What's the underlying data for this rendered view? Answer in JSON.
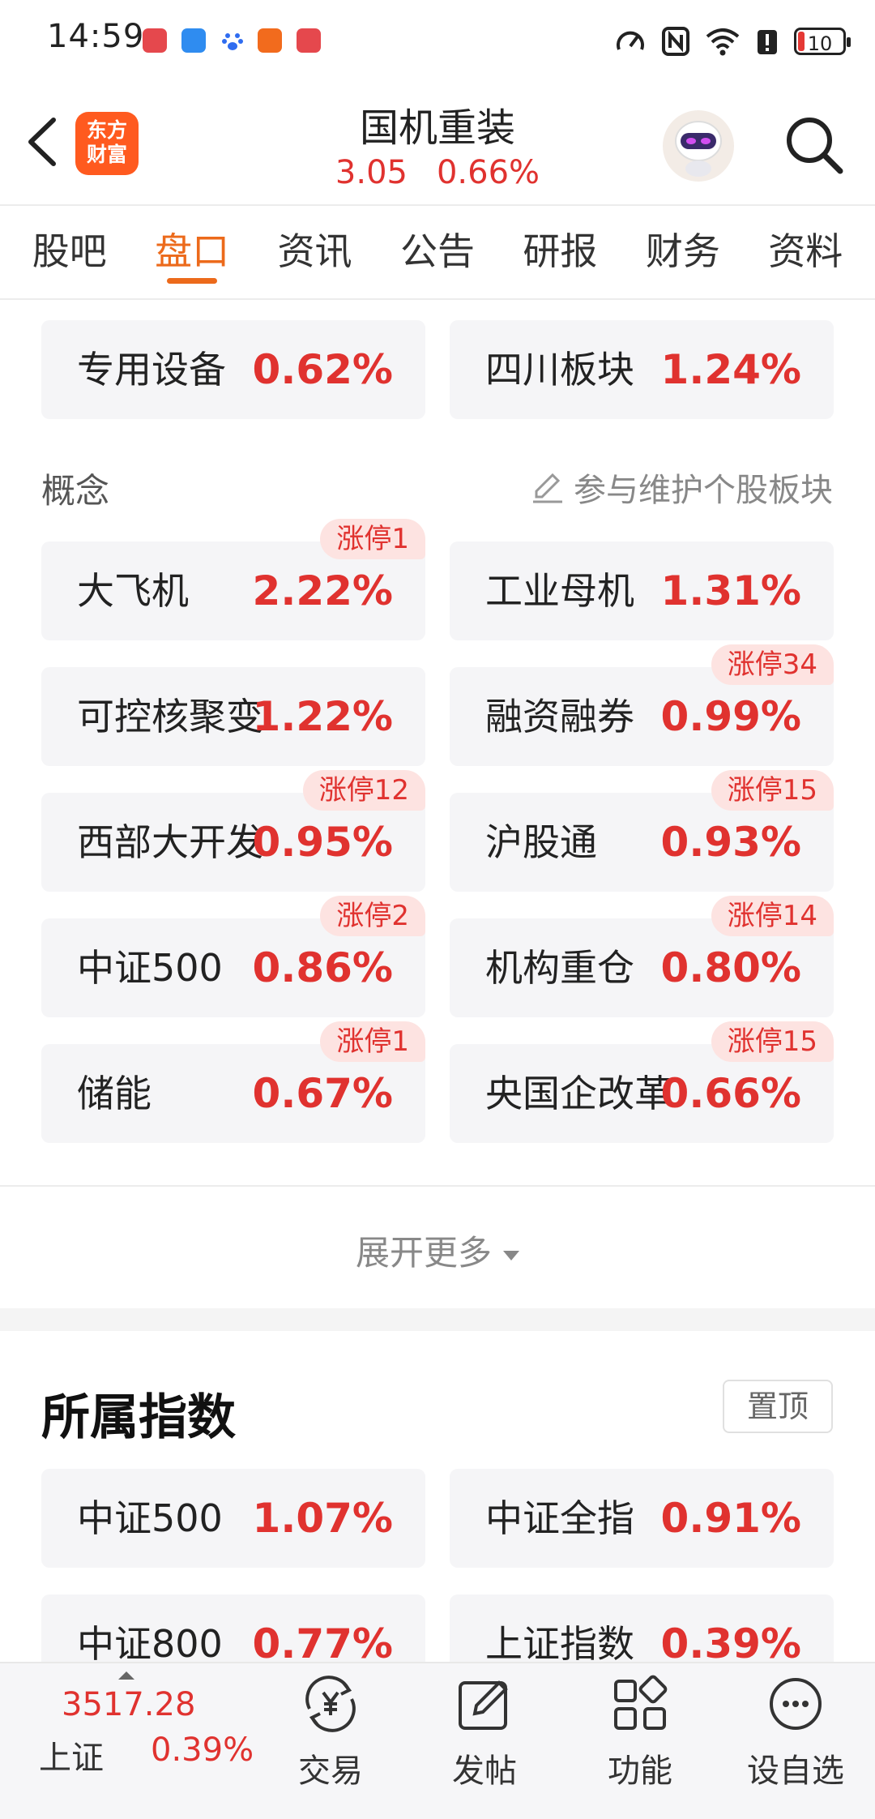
{
  "status_bar": {
    "time": "14:59",
    "battery": "10",
    "notification_icons": [
      "huawei-icon",
      "shield-app-icon",
      "paw-app-icon",
      "send-app-icon",
      "huawei-icon"
    ],
    "status_icons": [
      "speed-icon",
      "nfc-icon",
      "wifi-icon",
      "alert-icon",
      "battery-icon"
    ]
  },
  "header": {
    "logo_line1": "东方",
    "logo_line2": "财富",
    "title": "国机重装",
    "price": "3.05",
    "change": "0.66%"
  },
  "tabs": [
    {
      "label": "股吧",
      "active": false
    },
    {
      "label": "盘口",
      "active": true
    },
    {
      "label": "资讯",
      "active": false
    },
    {
      "label": "公告",
      "active": false
    },
    {
      "label": "研报",
      "active": false
    },
    {
      "label": "财务",
      "active": false
    },
    {
      "label": "资料",
      "active": false
    }
  ],
  "industry": [
    {
      "name": "专用设备",
      "pct": "0.62%"
    },
    {
      "name": "四川板块",
      "pct": "1.24%"
    }
  ],
  "concept_section": {
    "label": "概念",
    "maintain_label": "参与维护个股板块"
  },
  "concepts": [
    {
      "name": "大飞机",
      "pct": "2.22%",
      "badge": "涨停1"
    },
    {
      "name": "工业母机",
      "pct": "1.31%",
      "badge": ""
    },
    {
      "name": "可控核聚变",
      "pct": "1.22%",
      "badge": ""
    },
    {
      "name": "融资融券",
      "pct": "0.99%",
      "badge": "涨停34"
    },
    {
      "name": "西部大开发",
      "pct": "0.95%",
      "badge": "涨停12"
    },
    {
      "name": "沪股通",
      "pct": "0.93%",
      "badge": "涨停15"
    },
    {
      "name": "中证500",
      "pct": "0.86%",
      "badge": "涨停2"
    },
    {
      "name": "机构重仓",
      "pct": "0.80%",
      "badge": "涨停14"
    },
    {
      "name": "储能",
      "pct": "0.67%",
      "badge": "涨停1"
    },
    {
      "name": "央国企改革",
      "pct": "0.66%",
      "badge": "涨停15"
    }
  ],
  "expand_label": "展开更多",
  "index_section": {
    "title": "所属指数",
    "pin_label": "置顶",
    "items": [
      {
        "name": "中证500",
        "pct": "1.07%"
      },
      {
        "name": "中证全指",
        "pct": "0.91%"
      },
      {
        "name": "中证800",
        "pct": "0.77%"
      },
      {
        "name": "上证指数",
        "pct": "0.39%"
      }
    ]
  },
  "bottom_bar": {
    "index_value": "3517.28",
    "index_name": "上证",
    "index_pct": "0.39%",
    "nav": [
      {
        "label": "交易",
        "icon": "yuan-exchange-icon"
      },
      {
        "label": "发帖",
        "icon": "edit-post-icon"
      },
      {
        "label": "功能",
        "icon": "grid-apps-icon"
      },
      {
        "label": "设自选",
        "icon": "more-dots-icon"
      }
    ]
  },
  "colors": {
    "accent": "#ec6a1b",
    "up_red": "#e0322f",
    "badge_bg": "#fde3e1",
    "card_bg": "#f5f5f7"
  }
}
